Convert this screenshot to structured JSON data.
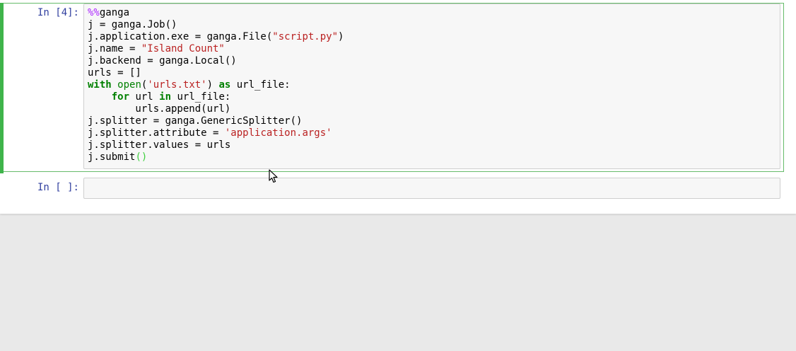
{
  "cells": [
    {
      "prompt": "In [4]:",
      "selected": true,
      "lines": [
        [
          {
            "t": "%%",
            "c": "magic"
          },
          {
            "t": "ganga",
            "c": ""
          }
        ],
        [
          {
            "t": "j = ganga.Job()",
            "c": ""
          }
        ],
        [
          {
            "t": "j.application.exe = ganga.File(",
            "c": ""
          },
          {
            "t": "\"script.py\"",
            "c": "str"
          },
          {
            "t": ")",
            "c": ""
          }
        ],
        [
          {
            "t": "j.name = ",
            "c": ""
          },
          {
            "t": "\"Island Count\"",
            "c": "str"
          }
        ],
        [
          {
            "t": "j.backend = ganga.Local()",
            "c": ""
          }
        ],
        [
          {
            "t": "urls = []",
            "c": ""
          }
        ],
        [
          {
            "t": "with",
            "c": "kw"
          },
          {
            "t": " ",
            "c": ""
          },
          {
            "t": "open",
            "c": "bi"
          },
          {
            "t": "(",
            "c": ""
          },
          {
            "t": "'urls.txt'",
            "c": "str"
          },
          {
            "t": ") ",
            "c": ""
          },
          {
            "t": "as",
            "c": "kw"
          },
          {
            "t": " url_file:",
            "c": ""
          }
        ],
        [
          {
            "t": "    ",
            "c": ""
          },
          {
            "t": "for",
            "c": "kw"
          },
          {
            "t": " url ",
            "c": ""
          },
          {
            "t": "in",
            "c": "kw"
          },
          {
            "t": " url_file:",
            "c": ""
          }
        ],
        [
          {
            "t": "        urls.append(url)",
            "c": ""
          }
        ],
        [
          {
            "t": "j.splitter = ganga.GenericSplitter()",
            "c": ""
          }
        ],
        [
          {
            "t": "j.splitter.attribute = ",
            "c": ""
          },
          {
            "t": "'application.args'",
            "c": "str"
          }
        ],
        [
          {
            "t": "j.splitter.values = urls",
            "c": ""
          }
        ],
        [
          {
            "t": "j.submit",
            "c": ""
          },
          {
            "t": "()",
            "c": "paren"
          }
        ]
      ]
    },
    {
      "prompt": "In [ ]:",
      "selected": false,
      "lines": []
    }
  ],
  "icons": {
    "cursor": "mouse-pointer-icon"
  }
}
